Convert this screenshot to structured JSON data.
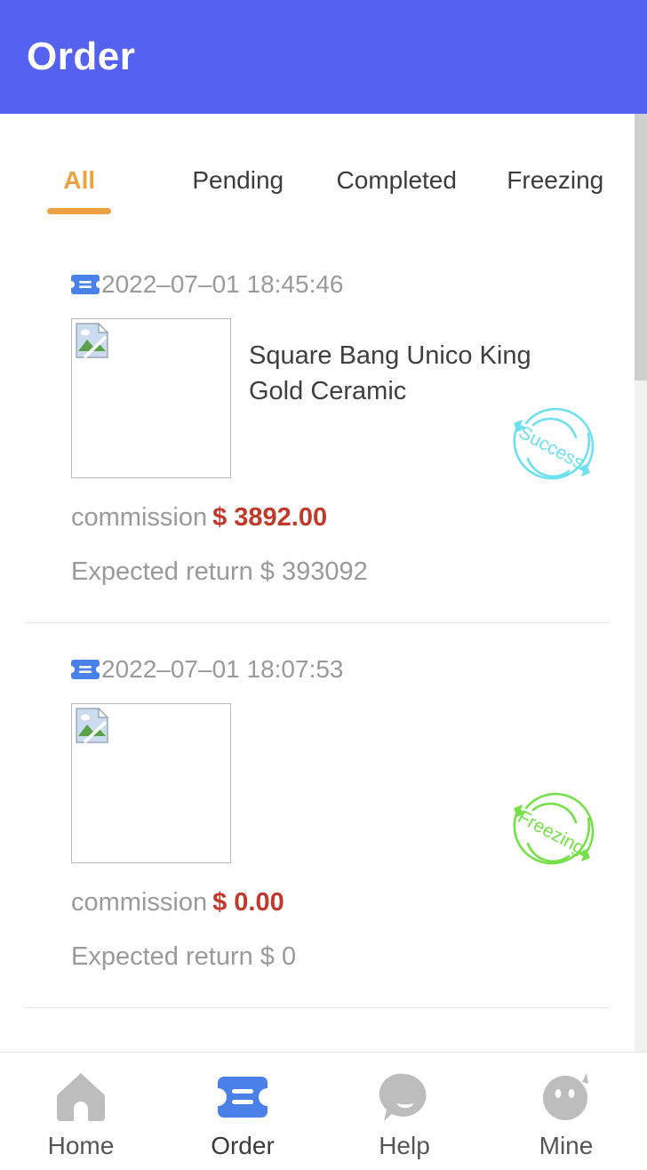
{
  "header": {
    "title": "Order",
    "bg_color": "#5562f0"
  },
  "tabs": {
    "active_index": 0,
    "accent_color": "#eda140",
    "items": [
      {
        "label": "All"
      },
      {
        "label": "Pending"
      },
      {
        "label": "Completed"
      },
      {
        "label": "Freezing"
      }
    ]
  },
  "orders": [
    {
      "icon": "ticket-icon",
      "time": "2022–07–01 18:45:46",
      "thumbnail": "broken-image-icon",
      "title": "Square Bang Unico King Gold Ceramic",
      "commission_label": "commission",
      "commission_value": "$ 3892.00",
      "commission_color": "#c0392b",
      "expected_return": "Expected return $ 393092",
      "status_stamp": "Success",
      "status_color": "#6fe0ef"
    },
    {
      "icon": "ticket-icon",
      "time": "2022–07–01 18:07:53",
      "thumbnail": "broken-image-icon",
      "title": "",
      "commission_label": "commission",
      "commission_value": "$ 0.00",
      "commission_color": "#c0392b",
      "expected_return": "Expected return $ 0",
      "status_stamp": "Freezing",
      "status_color": "#76e04a"
    }
  ],
  "bottom_nav": {
    "active_index": 1,
    "active_color": "#4a81e8",
    "inactive_color": "#bdbdbd",
    "items": [
      {
        "label": "Home",
        "icon": "home-icon"
      },
      {
        "label": "Order",
        "icon": "ticket-icon"
      },
      {
        "label": "Help",
        "icon": "chat-bubble-icon"
      },
      {
        "label": "Mine",
        "icon": "profile-icon"
      }
    ]
  }
}
